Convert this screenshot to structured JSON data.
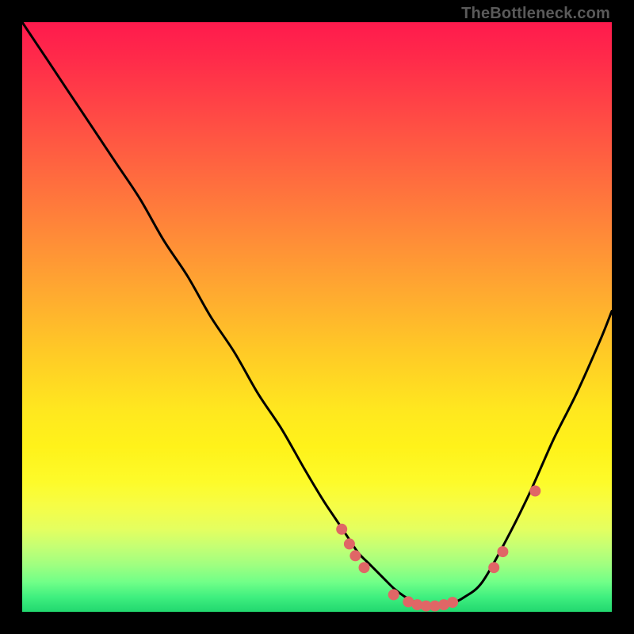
{
  "watermark": "TheBottleneck.com",
  "chart_data": {
    "type": "line",
    "title": "",
    "xlabel": "",
    "ylabel": "",
    "xlim": [
      0,
      100
    ],
    "ylim": [
      0,
      100
    ],
    "series": [
      {
        "name": "bottleneck-curve",
        "x": [
          0,
          4,
          8,
          12,
          16,
          20,
          24,
          28,
          32,
          36,
          40,
          44,
          48,
          51,
          53,
          55,
          57,
          59,
          61,
          63,
          65,
          67,
          69,
          71,
          73,
          75,
          78,
          82,
          86,
          90,
          94,
          98,
          100
        ],
        "y": [
          100,
          94,
          88,
          82,
          76,
          70,
          63,
          57,
          50,
          44,
          37,
          31,
          24,
          19,
          16,
          13,
          10,
          8,
          6,
          4,
          2.5,
          1.5,
          1,
          1,
          1.5,
          2.5,
          5,
          12,
          20,
          29,
          37,
          46,
          51
        ]
      }
    ],
    "markers": [
      {
        "x": 54.2,
        "y": 14.0
      },
      {
        "x": 55.5,
        "y": 11.5
      },
      {
        "x": 56.5,
        "y": 9.5
      },
      {
        "x": 58.0,
        "y": 7.5
      },
      {
        "x": 63.0,
        "y": 2.9
      },
      {
        "x": 65.5,
        "y": 1.7
      },
      {
        "x": 67.0,
        "y": 1.2
      },
      {
        "x": 68.5,
        "y": 1.0
      },
      {
        "x": 70.0,
        "y": 1.0
      },
      {
        "x": 71.5,
        "y": 1.2
      },
      {
        "x": 73.0,
        "y": 1.6
      },
      {
        "x": 80.0,
        "y": 7.5
      },
      {
        "x": 81.5,
        "y": 10.2
      },
      {
        "x": 87.0,
        "y": 20.5
      }
    ],
    "marker_color": "#e06666",
    "curve_color": "#000000"
  }
}
